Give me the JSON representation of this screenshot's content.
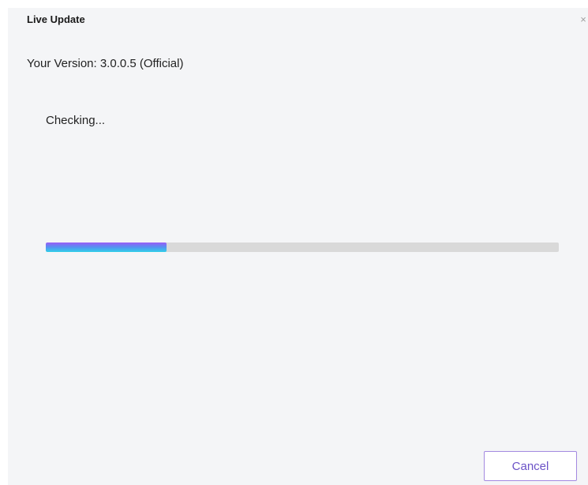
{
  "dialog": {
    "title": "Live Update",
    "close_glyph": "×",
    "close_icon": "close-icon",
    "version_text": "Your Version: 3.0.0.5 (Official)",
    "status_text": "Checking...",
    "progress_fraction": 0.235,
    "cancel_label": "Cancel"
  },
  "colors": {
    "background": "#f4f5f7",
    "track": "#d9d9d9",
    "fill_gradient": [
      "#9b5cf6",
      "#5a8cf2",
      "#2fd0e8"
    ],
    "accent": "#6b52c7"
  }
}
